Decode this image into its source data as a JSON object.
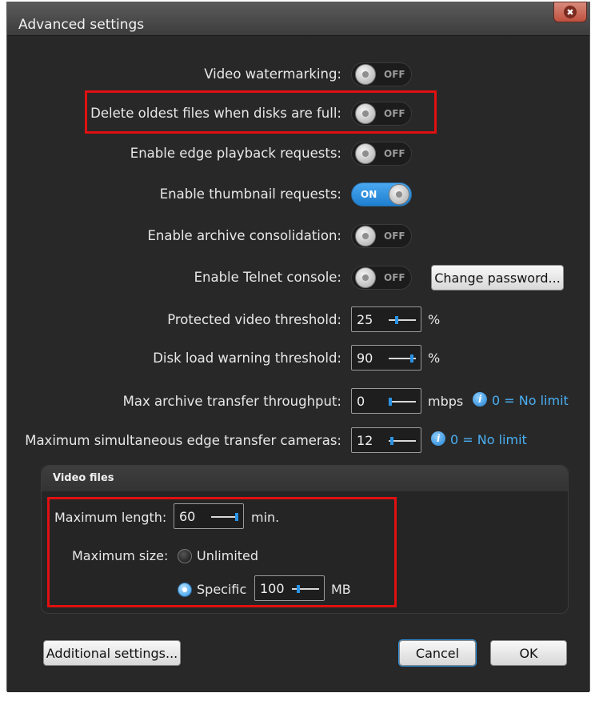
{
  "window": {
    "title": "Advanced settings",
    "close_label": "✖"
  },
  "settings": [
    {
      "label": "Video watermarking:",
      "state": "OFF"
    },
    {
      "label": "Delete oldest files when disks are full:",
      "state": "OFF"
    },
    {
      "label": "Enable edge playback requests:",
      "state": "OFF"
    },
    {
      "label": "Enable thumbnail requests:",
      "state": "ON"
    },
    {
      "label": "Enable archive consolidation:",
      "state": "OFF"
    },
    {
      "label": "Enable Telnet console:",
      "state": "OFF"
    }
  ],
  "telnet": {
    "change_password_label": "Change password..."
  },
  "thresholds": [
    {
      "label": "Protected video threshold:",
      "value": "25",
      "unit": "%",
      "slider_fraction": 0.25
    },
    {
      "label": "Disk load warning threshold:",
      "value": "90",
      "unit": "%",
      "slider_fraction": 0.9
    },
    {
      "label": "Max archive transfer throughput:",
      "value": "0",
      "unit": "mbps",
      "info": "0 = No limit",
      "slider_fraction": 0.0
    },
    {
      "label": "Maximum simultaneous edge transfer cameras:",
      "value": "12",
      "unit": "",
      "info": "0 = No limit",
      "slider_fraction": 0.05
    }
  ],
  "video_files": {
    "header": "Video files",
    "max_length_label": "Maximum length:",
    "max_length_value": "60",
    "max_length_unit": "min.",
    "max_size_label": "Maximum size:",
    "unlimited_label": "Unlimited",
    "specific_label": "Specific",
    "specific_value": "100",
    "specific_unit": "MB",
    "selected": "Specific"
  },
  "footer": {
    "additional_label": "Additional settings...",
    "cancel_label": "Cancel",
    "ok_label": "OK"
  },
  "colors": {
    "accent": "#2a94e6",
    "highlight": "#e01010",
    "background": "#282828"
  }
}
